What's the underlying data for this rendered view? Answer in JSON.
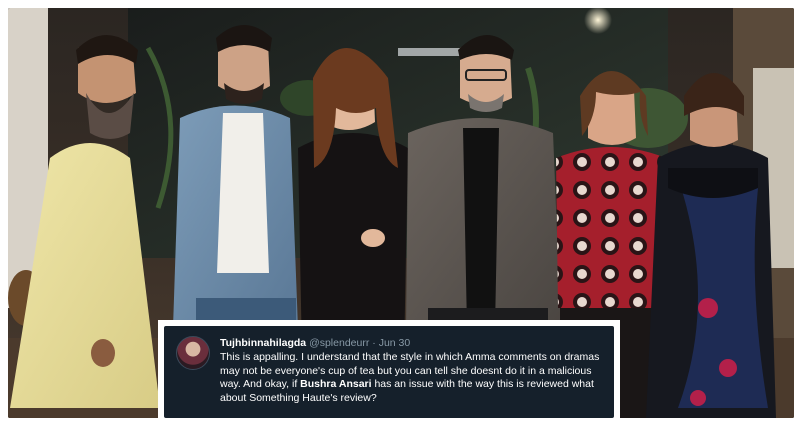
{
  "tweet": {
    "display_name": "Tujhbinnahilagda",
    "handle": "@splendeurr",
    "separator": "·",
    "date": "Jun 30",
    "text_part1": "This is appalling. I understand that the style in which Amma comments on dramas may not be everyone's cup of tea but you can tell she doesnt do it in a malicious way. And okay, if ",
    "text_bold": "Bushra Ansari",
    "text_part2": " has an issue with the way this is reviewed what about Something Haute's review?"
  },
  "photo": {
    "description_icon": "group-photo-image"
  }
}
